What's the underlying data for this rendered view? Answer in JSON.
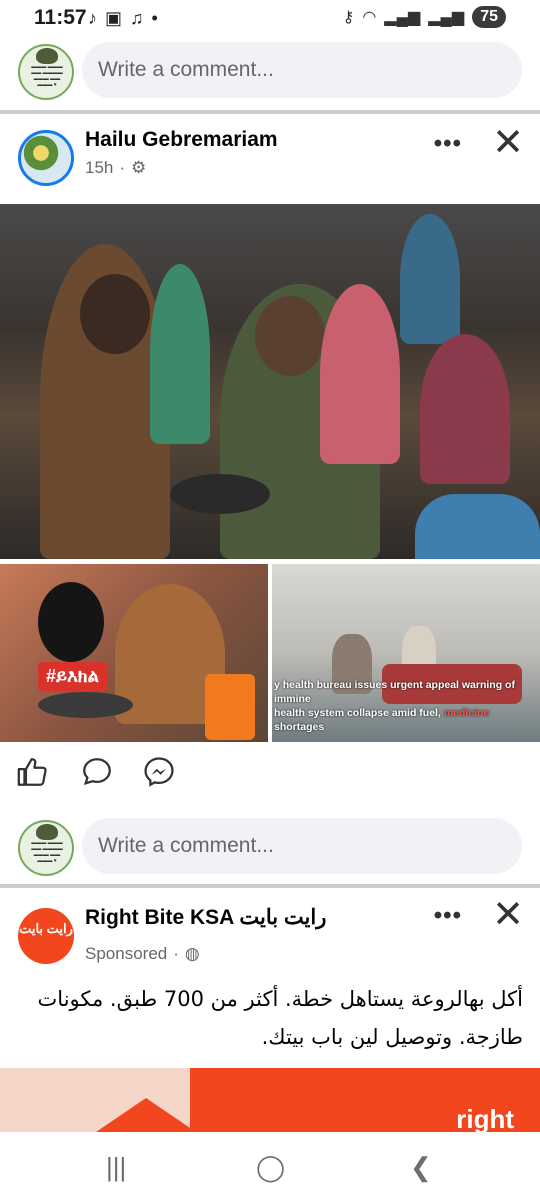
{
  "status": {
    "time": "11:57",
    "battery": "75"
  },
  "comment_top": {
    "placeholder": "Write a comment..."
  },
  "post": {
    "author": "Hailu Gebremariam",
    "time": "15h",
    "tag_text": "#ይእክል",
    "caption_line1": "y health bureau issues urgent appeal warning of immine",
    "caption_line2_a": "health system collapse amid fuel, ",
    "caption_line2_b": "medicine",
    "caption_line2_c": " shortages"
  },
  "comment_bottom": {
    "placeholder": "Write a comment..."
  },
  "sponsored": {
    "name": "Right Bite KSA رايت بايت",
    "label": "Sponsored",
    "avatar_text": "رايت بايت",
    "body": "أكل بهالروعة يستاهل خطة. أكثر من 700 طبق. مكونات طازجة. وتوصيل لين باب بيتك.",
    "banner_brand": "right"
  },
  "colors": {
    "accent": "#1877f2",
    "ad": "#f2461e",
    "muted": "#65676b"
  }
}
